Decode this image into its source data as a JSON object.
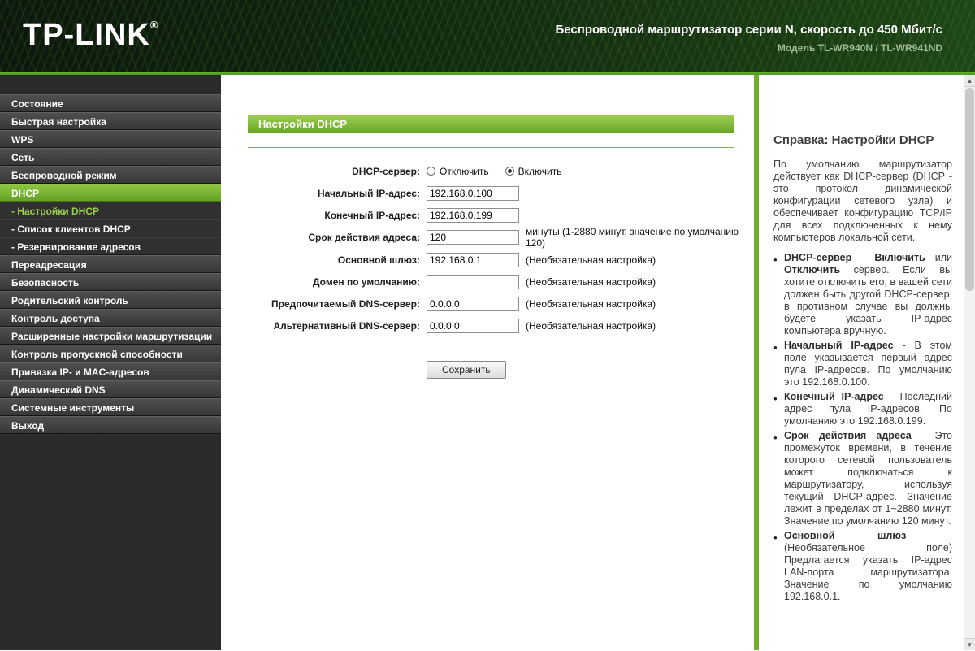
{
  "header": {
    "logo": "TP-LINK",
    "logo_reg": "®",
    "tagline": "Беспроводной маршрутизатор серии N, скорость до 450 Мбит/с",
    "model": "Модель TL-WR940N / TL-WR941ND"
  },
  "icons": {
    "scroll_up": "▲",
    "scroll_down": "▼"
  },
  "sidebar": {
    "items": [
      {
        "id": "status",
        "label": "Состояние",
        "type": "main",
        "active": false
      },
      {
        "id": "quick-setup",
        "label": "Быстрая настройка",
        "type": "main",
        "active": false
      },
      {
        "id": "wps",
        "label": "WPS",
        "type": "main",
        "active": false
      },
      {
        "id": "network",
        "label": "Сеть",
        "type": "main",
        "active": false
      },
      {
        "id": "wireless",
        "label": "Беспроводной режим",
        "type": "main",
        "active": false
      },
      {
        "id": "dhcp",
        "label": "DHCP",
        "type": "main",
        "active": true
      },
      {
        "id": "dhcp-settings",
        "label": "- Настройки DHCP",
        "type": "sub",
        "active": true
      },
      {
        "id": "dhcp-clients-list",
        "label": "- Список клиентов DHCP",
        "type": "sub",
        "active": false
      },
      {
        "id": "address-reservation",
        "label": "- Резервирование адресов",
        "type": "sub",
        "active": false
      },
      {
        "id": "forwarding",
        "label": "Переадресация",
        "type": "main",
        "active": false
      },
      {
        "id": "security",
        "label": "Безопасность",
        "type": "main",
        "active": false
      },
      {
        "id": "parental-control",
        "label": "Родительский контроль",
        "type": "main",
        "active": false
      },
      {
        "id": "access-control",
        "label": "Контроль доступа",
        "type": "main",
        "active": false
      },
      {
        "id": "advanced-routing",
        "label": "Расширенные настройки маршрутизации",
        "type": "main",
        "active": false
      },
      {
        "id": "bandwidth-control",
        "label": "Контроль пропускной способности",
        "type": "main",
        "active": false
      },
      {
        "id": "ip-mac-binding",
        "label": "Привязка IP- и MAC-адресов",
        "type": "main",
        "active": false
      },
      {
        "id": "dynamic-dns",
        "label": "Динамический DNS",
        "type": "main",
        "active": false
      },
      {
        "id": "system-tools",
        "label": "Системные инструменты",
        "type": "main",
        "active": false
      },
      {
        "id": "logout",
        "label": "Выход",
        "type": "main",
        "active": false
      }
    ]
  },
  "content": {
    "title": "Настройки DHCP",
    "form": {
      "dhcp_server": {
        "label": "DHCP-сервер:",
        "options": [
          "Отключить",
          "Включить"
        ],
        "selected": "Включить"
      },
      "start_ip": {
        "label": "Начальный IP-адрес:",
        "value": "192.168.0.100"
      },
      "end_ip": {
        "label": "Конечный IP-адрес:",
        "value": "192.168.0.199"
      },
      "lease_time": {
        "label": "Срок действия адреса:",
        "value": "120",
        "hint": "минуты (1-2880 минут, значение по умолчанию 120)"
      },
      "gateway": {
        "label": "Основной шлюз:",
        "value": "192.168.0.1",
        "hint": "(Необязательная настройка)"
      },
      "default_domain": {
        "label": "Домен по умолчанию:",
        "value": "",
        "hint": "(Необязательная настройка)"
      },
      "primary_dns": {
        "label": "Предпочитаемый DNS-сервер:",
        "value": "0.0.0.0",
        "hint": "(Необязательная настройка)"
      },
      "secondary_dns": {
        "label": "Альтернативный DNS-сервер:",
        "value": "0.0.0.0",
        "hint": "(Необязательная настройка)"
      }
    },
    "save_label": "Сохранить"
  },
  "help": {
    "title": "Справка: Настройки DHCP",
    "intro": "По умолчанию маршрутизатор действует как DHCP-сервер (DHCP - это протокол динамической конфигурации сетевого узла) и обеспечивает конфигурацию TCP/IP для всех подключенных к нему компьютеров локальной сети.",
    "items": [
      {
        "segments": [
          {
            "b": true,
            "t": "DHCP-сервер"
          },
          {
            "t": " - "
          },
          {
            "b": true,
            "t": "Включить"
          },
          {
            "t": " или "
          },
          {
            "b": true,
            "t": "Отключить"
          },
          {
            "t": " сервер. Если вы хотите отключить его, в вашей сети должен быть другой DHCP-сервер, в противном случае вы должны будете указать IP-адрес компьютера вручную."
          }
        ]
      },
      {
        "segments": [
          {
            "b": true,
            "t": "Начальный IP-адрес"
          },
          {
            "t": " - В этом поле указывается первый адрес пула IP-адресов. По умолчанию это 192.168.0.100."
          }
        ]
      },
      {
        "segments": [
          {
            "b": true,
            "t": "Конечный IP-адрес"
          },
          {
            "t": " - Последний адрес пула IP-адресов. По умолчанию это 192.168.0.199."
          }
        ]
      },
      {
        "segments": [
          {
            "b": true,
            "t": "Срок действия адреса"
          },
          {
            "t": " - Это промежуток времени, в течение которого сетевой пользователь может подключаться к маршрутизатору, используя текущий DHCP-адрес. Значение лежит в пределах от 1~2880 минут. Значение по умолчанию 120 минут."
          }
        ]
      },
      {
        "segments": [
          {
            "b": true,
            "t": "Основной шлюз"
          },
          {
            "t": " - (Необязательное поле) Предлагается указать IP-адрес LAN-порта маршрутизатора. Значение по умолчанию 192.168.0.1."
          }
        ]
      }
    ]
  }
}
